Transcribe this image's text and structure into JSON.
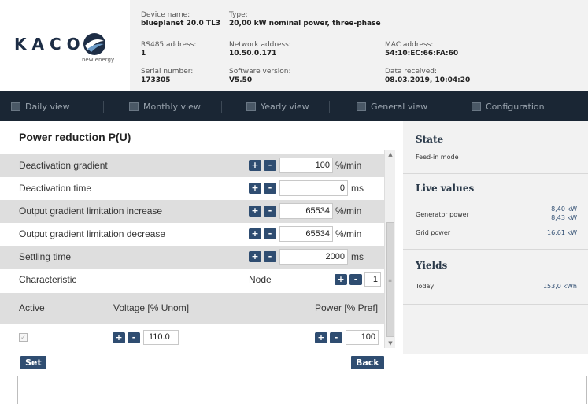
{
  "brand": {
    "name": "KACO",
    "tagline": "new energy."
  },
  "device_info": {
    "device_name_label": "Device name:",
    "device_name": "blueplanet 20.0 TL3",
    "type_label": "Type:",
    "type": "20,00 kW nominal power, three-phase",
    "rs485_label": "RS485 address:",
    "rs485": "1",
    "network_label": "Network address:",
    "network": "10.50.0.171",
    "mac_label": "MAC address:",
    "mac": "54:10:EC:66:FA:60",
    "serial_label": "Serial number:",
    "serial": "173305",
    "software_label": "Software version:",
    "software": "V5.50",
    "received_label": "Data received:",
    "received": "08.03.2019, 10:04:20"
  },
  "nav": {
    "items": [
      {
        "label": "Daily view",
        "icon": "calendar-day-icon"
      },
      {
        "label": "Monthly view",
        "icon": "calendar-month-icon"
      },
      {
        "label": "Yearly view",
        "icon": "calendar-year-icon"
      },
      {
        "label": "General view",
        "icon": "overview-icon"
      },
      {
        "label": "Configuration",
        "icon": "wrench-icon"
      }
    ]
  },
  "panel": {
    "title": "Power reduction P(U)",
    "rows": [
      {
        "label": "Deactivation gradient",
        "value": "100",
        "unit": "%/min"
      },
      {
        "label": "Deactivation time",
        "value": "0",
        "unit": "ms"
      },
      {
        "label": "Output gradient limitation increase",
        "value": "65534",
        "unit": "%/min"
      },
      {
        "label": "Output gradient limitation decrease",
        "value": "65534",
        "unit": "%/min"
      },
      {
        "label": "Settling time",
        "value": "2000",
        "unit": "ms"
      }
    ],
    "characteristic": {
      "label": "Characteristic",
      "node_label": "Node",
      "node_value": "1"
    },
    "table": {
      "col_active": "Active",
      "col_voltage": "Voltage [% Unom]",
      "col_power": "Power [% Pref]",
      "voltage_value": "110.0",
      "power_value": "100"
    },
    "plus": "+",
    "minus": "-",
    "set_label": "Set",
    "back_label": "Back"
  },
  "side": {
    "state_title": "State",
    "state_value": "Feed-in mode",
    "live_title": "Live values",
    "generator_label": "Generator power",
    "generator_value_1": "8,40 kW",
    "generator_value_2": "8,43 kW",
    "grid_label": "Grid power",
    "grid_value": "16,61 kW",
    "yields_title": "Yields",
    "today_label": "Today",
    "today_value": "153,0 kWh"
  }
}
